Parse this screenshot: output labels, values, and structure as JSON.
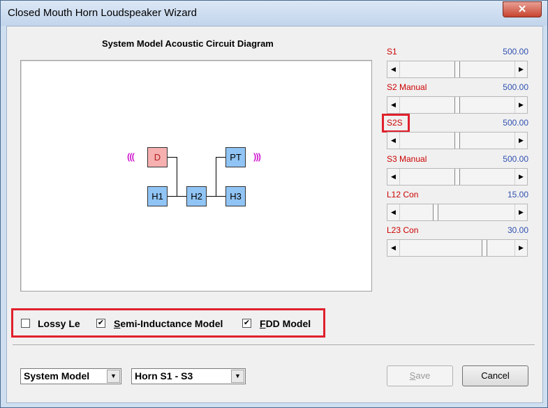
{
  "window": {
    "title": "Closed Mouth Horn Loudspeaker Wizard",
    "close_glyph": "✕"
  },
  "diagram": {
    "title": "System Model Acoustic Circuit Diagram",
    "nodes": {
      "d": "D",
      "pt": "PT",
      "h1": "H1",
      "h2": "H2",
      "h3": "H3"
    },
    "waves_left": "(((",
    "waves_right": ")))"
  },
  "sliders": [
    {
      "label": "S1",
      "value": "500.00",
      "fraction": 0.5
    },
    {
      "label": "S2 Manual",
      "value": "500.00",
      "fraction": 0.5
    },
    {
      "label": "S2S",
      "value": "500.00",
      "fraction": 0.5
    },
    {
      "label": "S3 Manual",
      "value": "500.00",
      "fraction": 0.5
    },
    {
      "label": "L12 Con",
      "value": "15.00",
      "fraction": 0.3
    },
    {
      "label": "L23 Con",
      "value": "30.00",
      "fraction": 0.75
    }
  ],
  "options": {
    "lossy_le": {
      "label": "Lossy Le",
      "checked": false
    },
    "semi_inductance": {
      "label_first": "S",
      "label_rest": "emi-Inductance Model",
      "checked": true
    },
    "fdd": {
      "label_first": "F",
      "label_rest": "DD Model",
      "checked": true
    },
    "check_glyph": "✔"
  },
  "footer": {
    "model_select": "System Model",
    "horn_select": "Horn S1 - S3",
    "dropdown_glyph": "▼",
    "save_first": "S",
    "save_rest": "ave",
    "cancel_label": "Cancel"
  },
  "glyphs": {
    "left": "◀",
    "right": "▶"
  },
  "colors": {
    "highlight": "#e0202c",
    "label_red": "#cc0000",
    "value_blue": "#3050b0"
  }
}
